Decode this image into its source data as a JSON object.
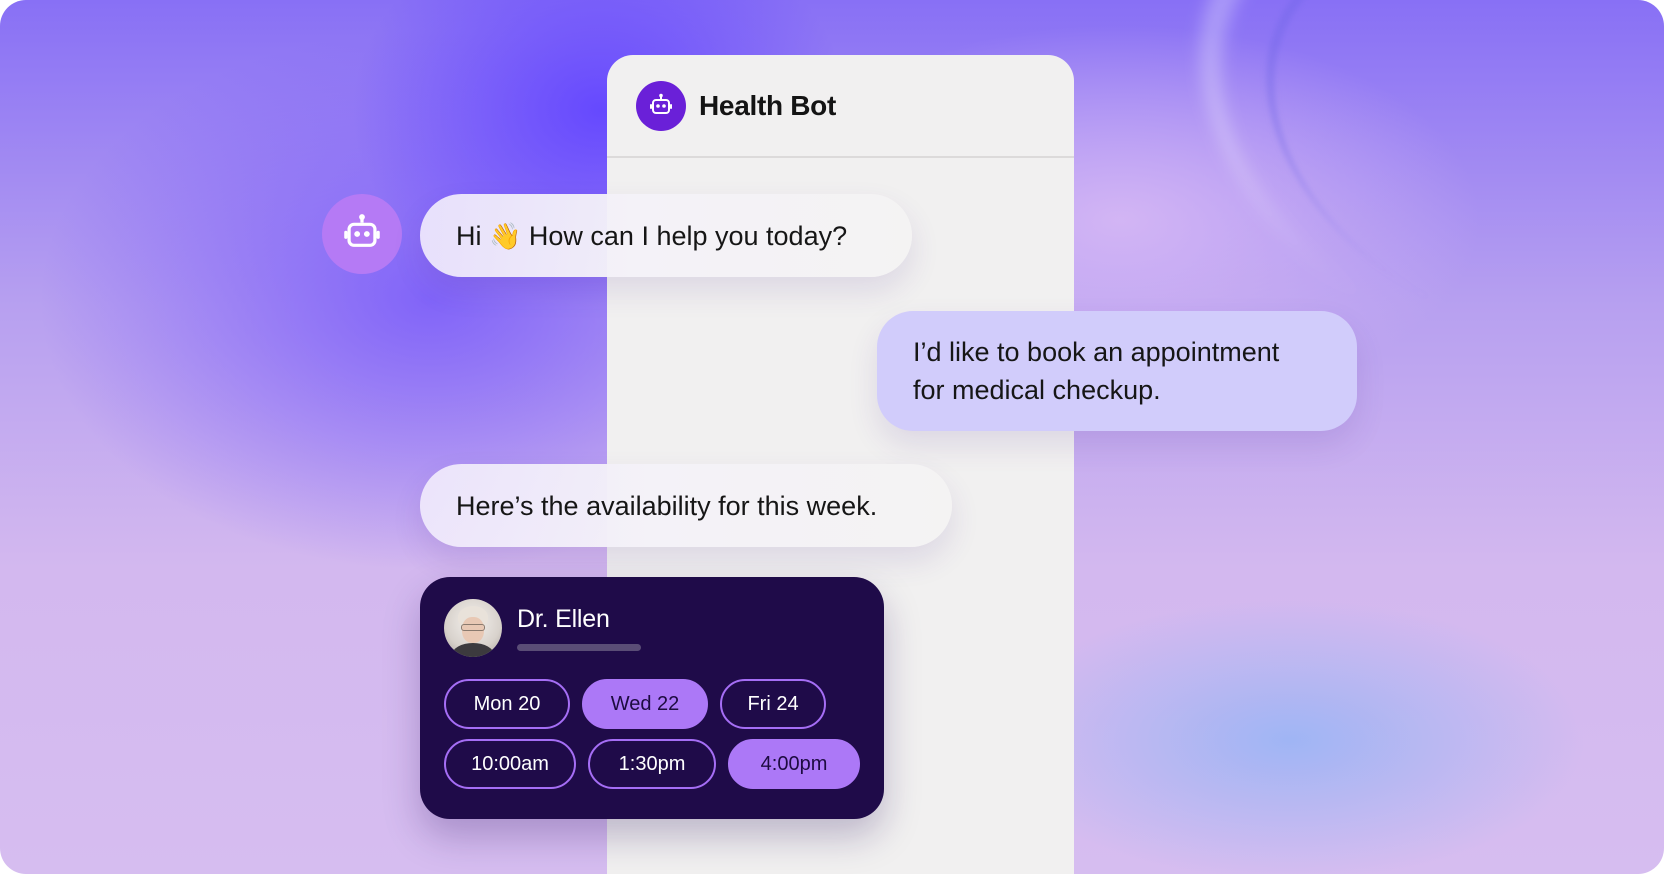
{
  "chat": {
    "title": "Health Bot",
    "bot_icon": "robot-icon"
  },
  "messages": {
    "greeting_prefix": "Hi",
    "greeting_emoji": "👋",
    "greeting_text": "How can I help you today?",
    "user_line1": "I’d like to book an appointment",
    "user_line2": "for medical checkup.",
    "availability": "Here’s the availability for this week."
  },
  "card": {
    "doctor_name": "Dr. Ellen",
    "days": [
      {
        "label": "Mon 20",
        "selected": false
      },
      {
        "label": "Wed 22",
        "selected": true
      },
      {
        "label": "Fri 24",
        "selected": false
      }
    ],
    "times": [
      {
        "label": "10:00am",
        "selected": false
      },
      {
        "label": "1:30pm",
        "selected": false
      },
      {
        "label": "4:00pm",
        "selected": true
      }
    ]
  },
  "colors": {
    "accent_purple": "#6a20d8",
    "slot_selected": "#ac78f7",
    "card_bg": "#1f0b49",
    "user_bubble": "#d1ccfb"
  }
}
